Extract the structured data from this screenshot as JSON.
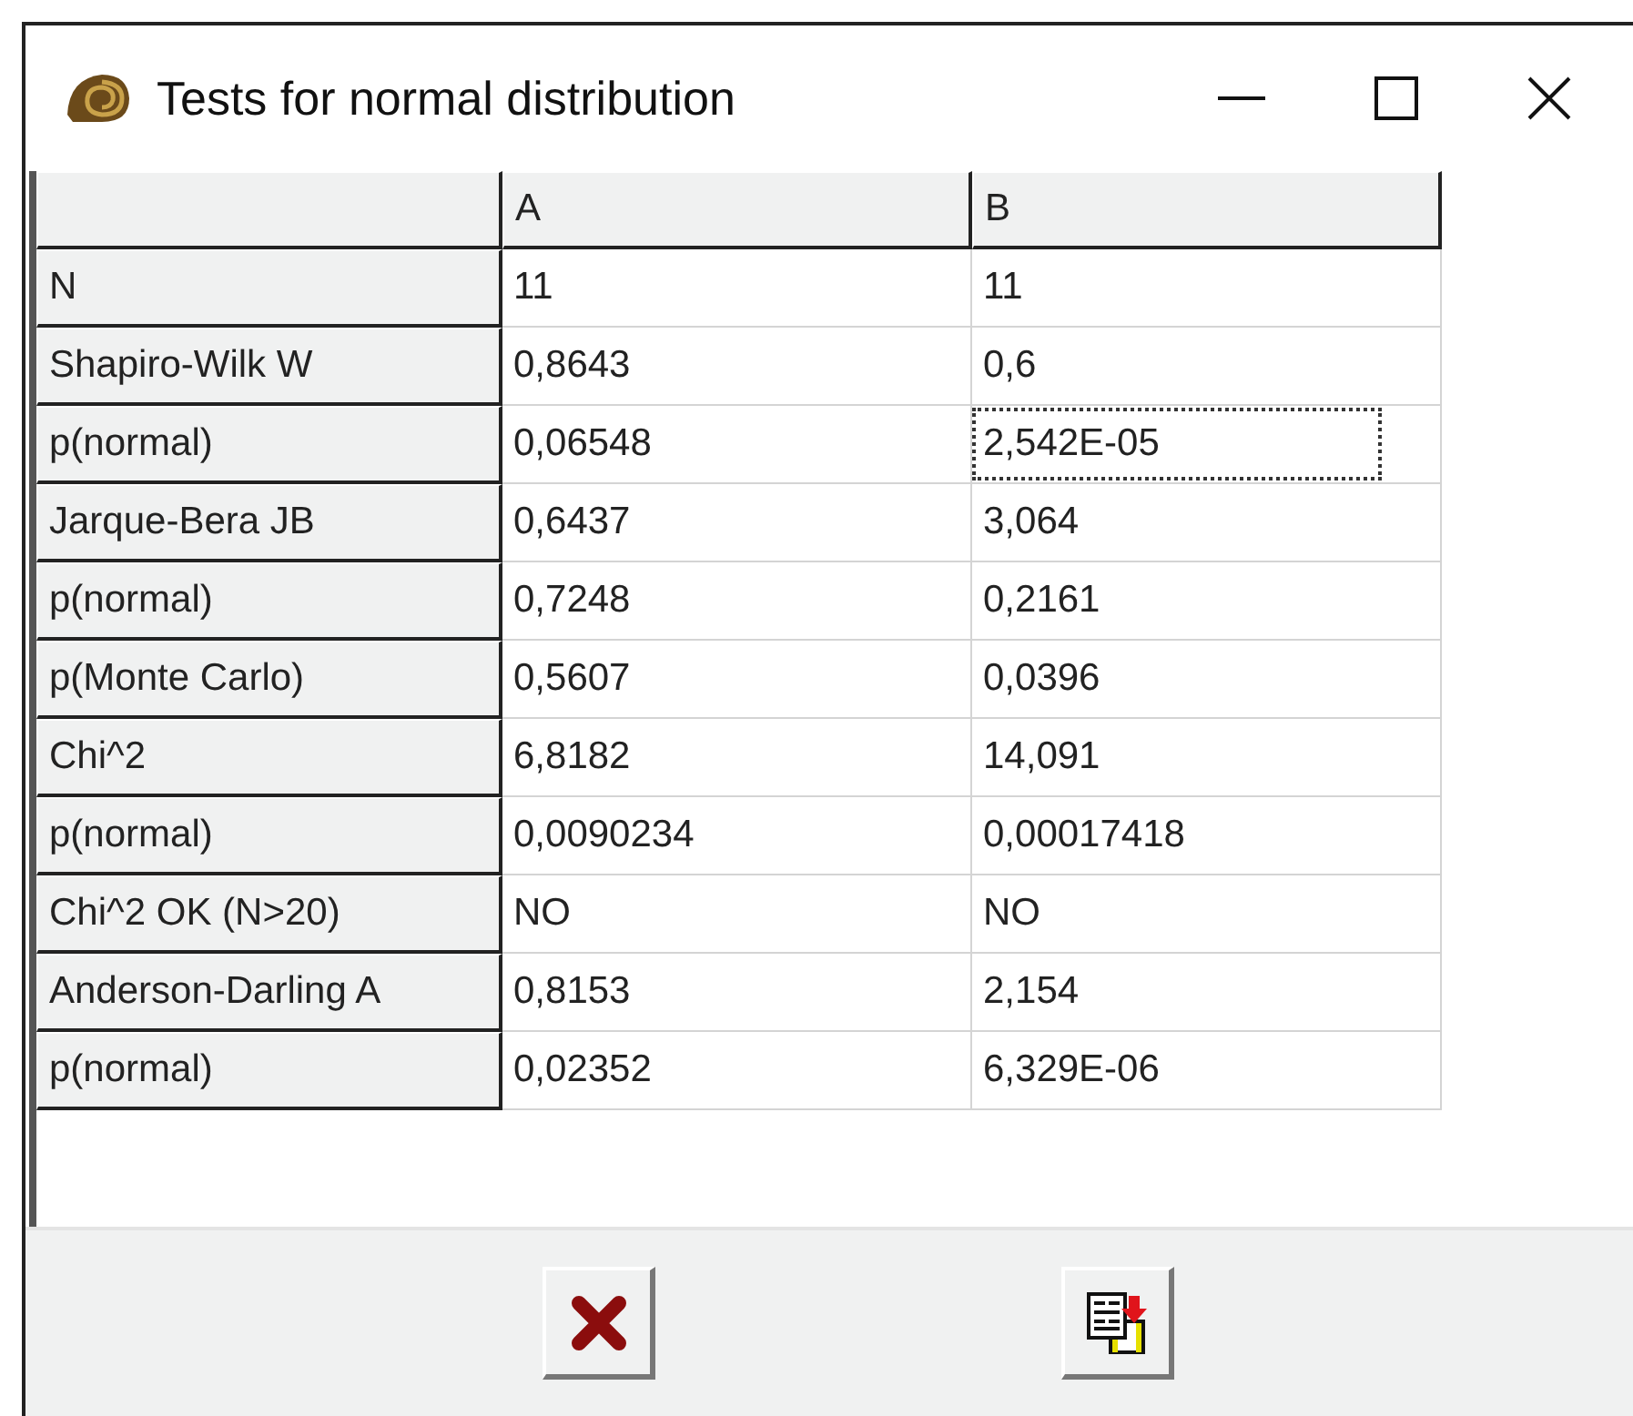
{
  "window": {
    "title": "Tests for normal distribution"
  },
  "table": {
    "columns": [
      "A",
      "B"
    ],
    "rows": [
      {
        "label": "N",
        "cells": [
          {
            "text": "11",
            "focused": false
          },
          {
            "text": "11",
            "focused": false
          }
        ]
      },
      {
        "label": "Shapiro-Wilk W",
        "cells": [
          {
            "text": "0,8643",
            "focused": false
          },
          {
            "text": "0,6",
            "focused": false
          }
        ]
      },
      {
        "label": "p(normal)",
        "cells": [
          {
            "text": "0,06548",
            "focused": false
          },
          {
            "text": "2,542E-05",
            "focused": true
          }
        ]
      },
      {
        "label": "Jarque-Bera JB",
        "cells": [
          {
            "text": "0,6437",
            "focused": false
          },
          {
            "text": "3,064",
            "focused": false
          }
        ]
      },
      {
        "label": "p(normal)",
        "cells": [
          {
            "text": "0,7248",
            "focused": false
          },
          {
            "text": "0,2161",
            "focused": false
          }
        ]
      },
      {
        "label": "p(Monte Carlo)",
        "cells": [
          {
            "text": "0,5607",
            "focused": false
          },
          {
            "text": "0,0396",
            "focused": false
          }
        ]
      },
      {
        "label": "Chi^2",
        "cells": [
          {
            "text": "6,8182",
            "focused": false
          },
          {
            "text": "14,091",
            "focused": false
          }
        ]
      },
      {
        "label": "p(normal)",
        "cells": [
          {
            "text": "0,0090234",
            "focused": false
          },
          {
            "text": "0,00017418",
            "focused": false
          }
        ]
      },
      {
        "label": "Chi^2 OK (N>20)",
        "cells": [
          {
            "text": "NO",
            "focused": false
          },
          {
            "text": "NO",
            "focused": false
          }
        ]
      },
      {
        "label": "Anderson-Darling A",
        "cells": [
          {
            "text": "0,8153",
            "focused": false
          },
          {
            "text": "2,154",
            "focused": false
          }
        ]
      },
      {
        "label": "p(normal)",
        "cells": [
          {
            "text": "0,02352",
            "focused": false
          },
          {
            "text": "6,329E-06",
            "focused": false
          }
        ]
      }
    ]
  },
  "buttons": [
    {
      "kind": "close"
    },
    {
      "kind": "copy"
    }
  ]
}
